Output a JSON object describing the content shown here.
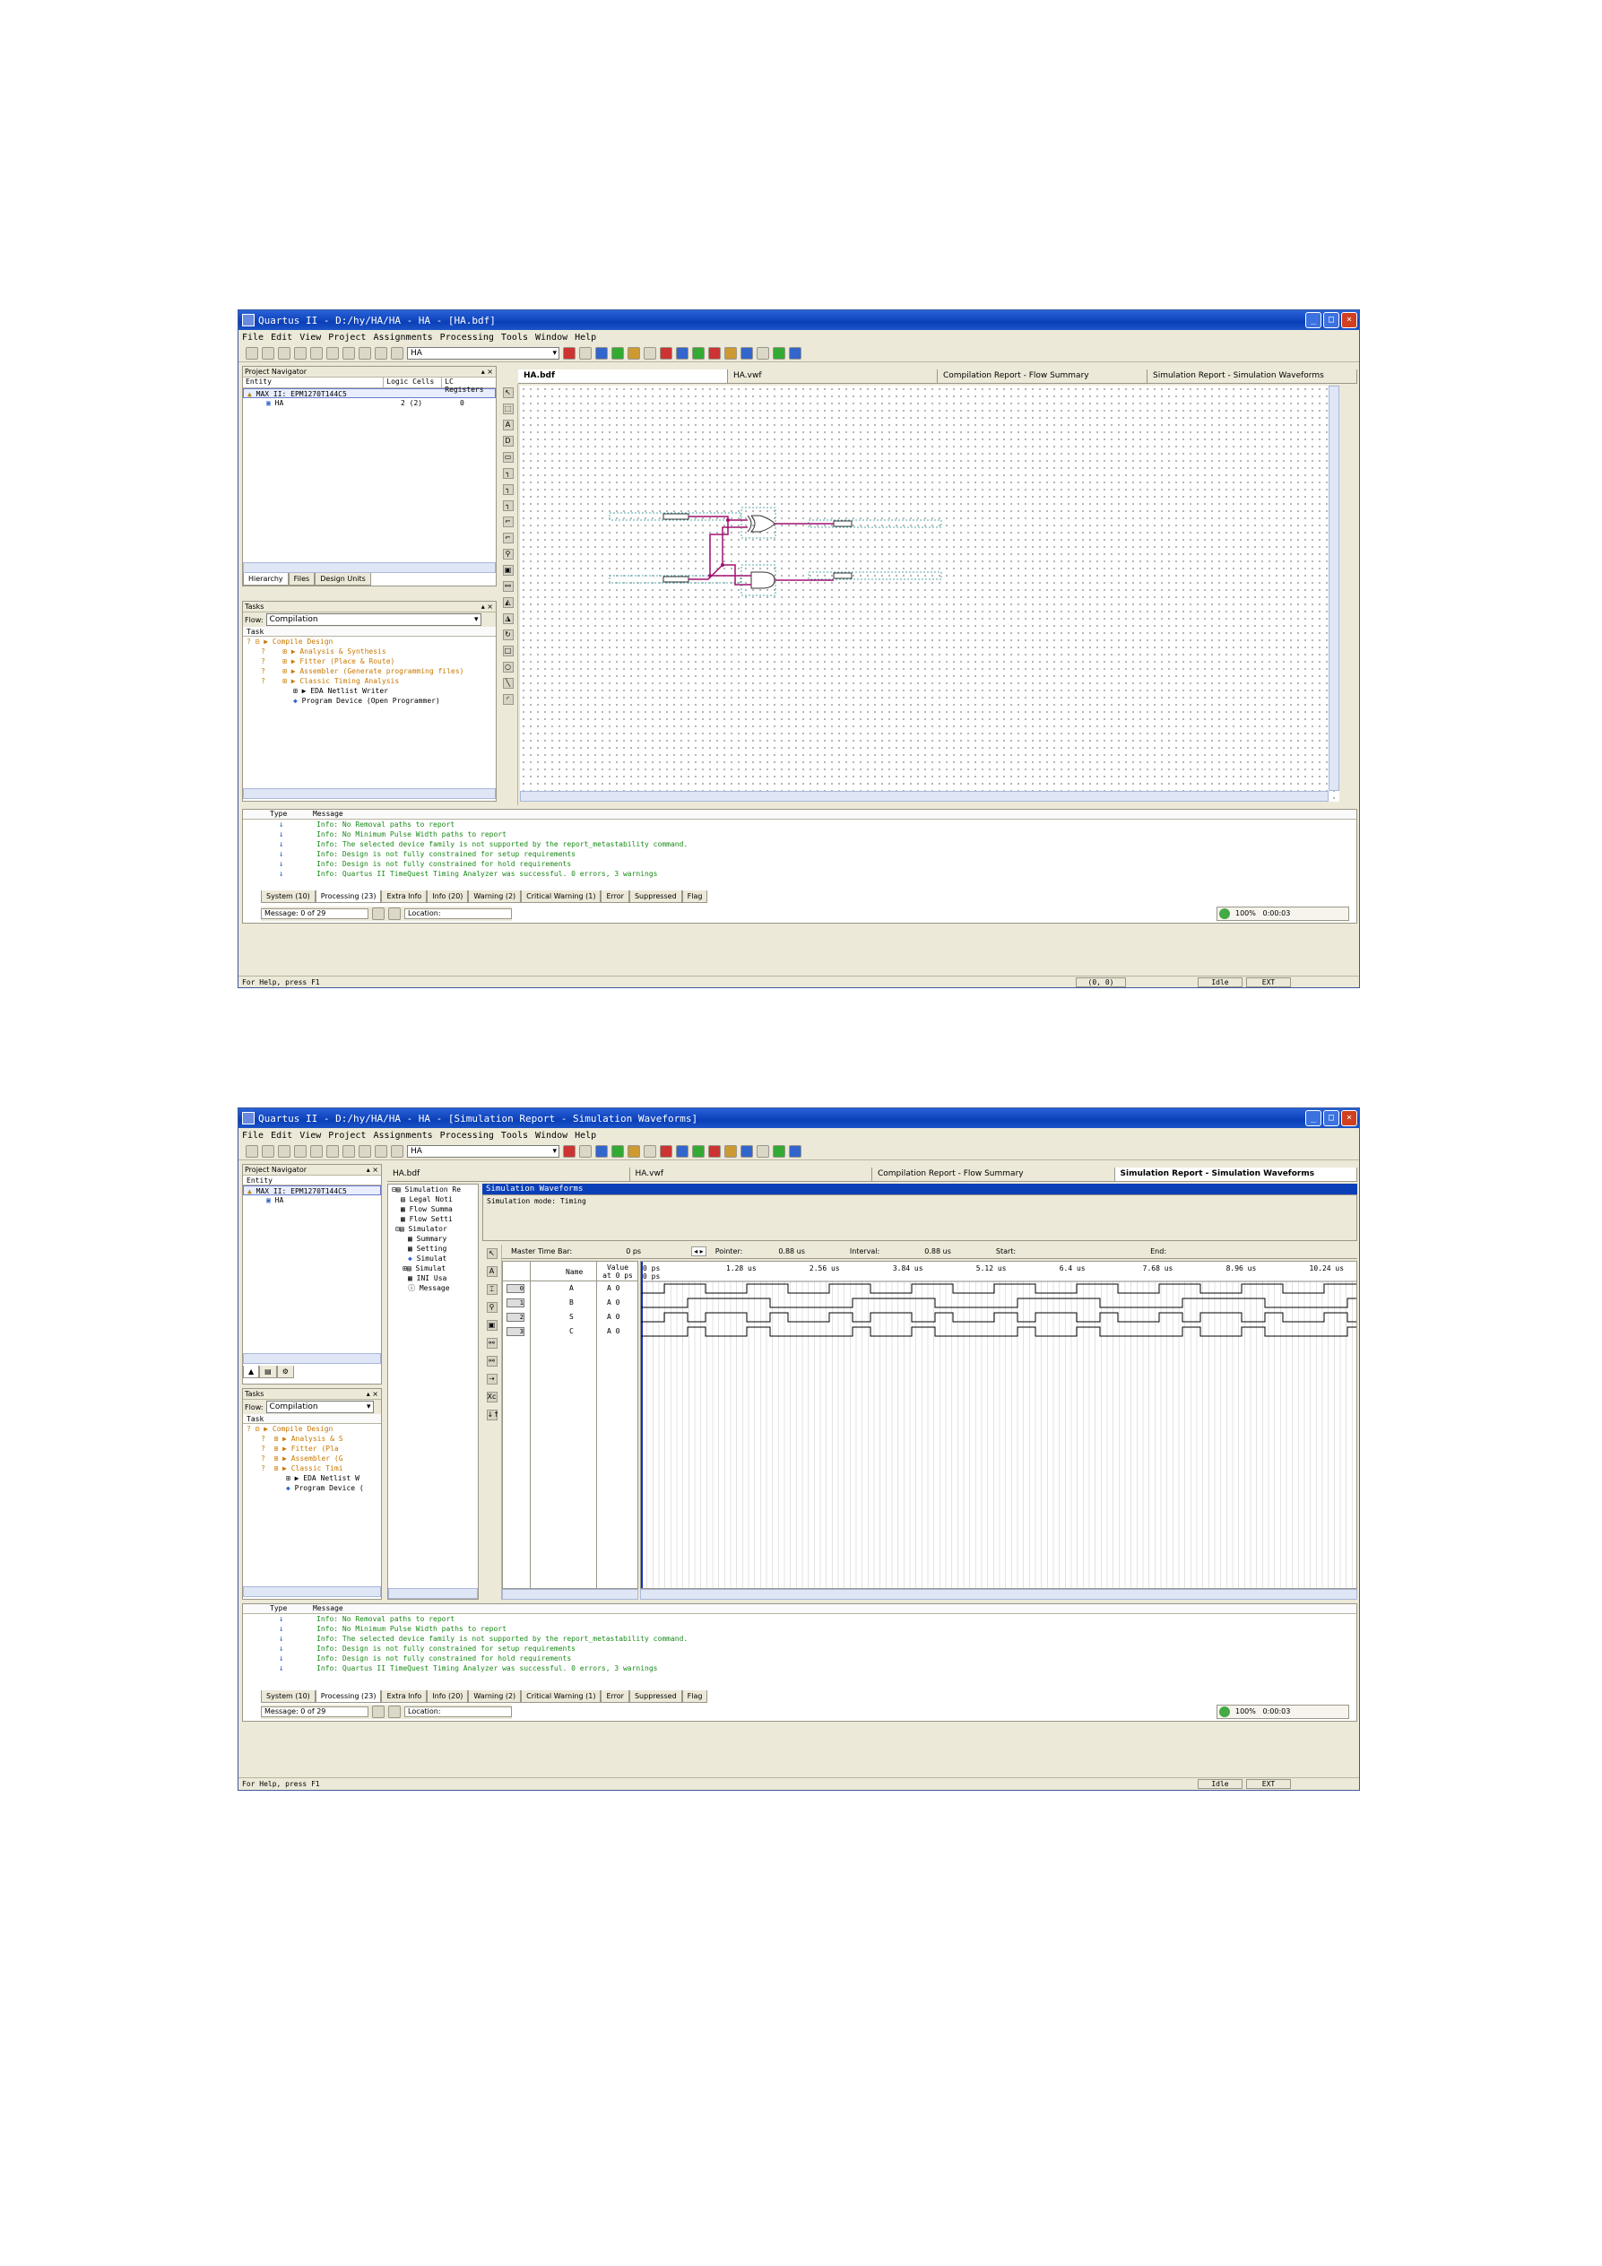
{
  "app": {
    "title1": "Quartus II - D:/hy/HA/HA - HA - [HA.bdf]",
    "title2": "Quartus II - D:/hy/HA/HA - HA - [Simulation Report - Simulation Waveforms]",
    "menu": [
      "File",
      "Edit",
      "View",
      "Project",
      "Assignments",
      "Processing",
      "Tools",
      "Window",
      "Help"
    ],
    "toolbar_project": "HA"
  },
  "navigator": {
    "header": "Project Navigator",
    "col_entity": "Entity",
    "col_logic": "Logic Cells",
    "col_lc": "LC Registers",
    "device": "MAX II: EPM1270T144C5",
    "device_short": "MAX II: EPM1270T144C5",
    "entity": "HA",
    "logic_cells": "2 (2)",
    "lc_regs": "0",
    "tabs": [
      "Hierarchy",
      "Files",
      "Design Units"
    ]
  },
  "tasks": {
    "header": "Tasks",
    "flow_label": "Flow:",
    "flow_value": "Compilation",
    "col": "Task",
    "items": [
      "Compile Design",
      "Analysis & Synthesis",
      "Fitter (Place & Route)",
      "Assembler (Generate programming files)",
      "Classic Timing Analysis",
      "EDA Netlist Writer",
      "Program Device (Open Programmer)"
    ],
    "items_short": [
      "Compile Design",
      "Analysis & S",
      "Fitter (Pla",
      "Assembler (G",
      "Classic Timi",
      "EDA Netlist W",
      "Program Device ("
    ]
  },
  "doc_tabs": [
    "HA.bdf",
    "HA.vwf",
    "Compilation Report - Flow Summary",
    "Simulation Report - Simulation Waveforms"
  ],
  "messages": {
    "col_type": "Type",
    "col_message": "Message",
    "lines": [
      "Info: No Removal paths to report",
      "Info: No Minimum Pulse Width paths to report",
      "Info: The selected device family is not supported by the report_metastability command.",
      "Info: Design is not fully constrained for setup requirements",
      "Info: Design is not fully constrained for hold requirements",
      "Info: Quartus II TimeQuest Timing Analyzer was successful. 0 errors, 3 warnings"
    ],
    "tabs": [
      "System (10)",
      "Processing (23)",
      "Extra Info",
      "Info (20)",
      "Warning (2)",
      "Critical Warning (1)",
      "Error",
      "Suppressed",
      "Flag"
    ],
    "counter": "Message: 0 of 29",
    "location": "Location:",
    "tray": "0:00:03",
    "tray_pct": "100%"
  },
  "status": {
    "help": "For Help, press F1",
    "idle": "Idle",
    "ext": "EXT",
    "coord": "(0, 0)"
  },
  "sim_tree": {
    "items": [
      "Simulation Report",
      "Legal Notice",
      "Flow Summary",
      "Flow Settings",
      "Simulator",
      "Summary",
      "Settings",
      "Simulation Waveforms",
      "Simulation Coverage",
      "INI Usage",
      "Messages"
    ],
    "items_short": [
      "Simulation Re",
      "Legal Noti",
      "Flow Summa",
      "Flow Setti",
      "Simulator",
      "Summary",
      "Setting",
      "Simulat",
      "Simulat",
      "INI Usa",
      "Message"
    ]
  },
  "waveform": {
    "heading": "Simulation Waveforms",
    "mode": "Simulation mode: Timing",
    "master_label": "Master Time Bar:",
    "master_val": "0 ps",
    "pointer_label": "Pointer:",
    "pointer_val": "0.88 us",
    "interval_label": "Interval:",
    "interval_val": "0.88 us",
    "start_label": "Start:",
    "end_label": "End:",
    "col_name": "Name",
    "col_value": "Value at 0 ps",
    "ticks": [
      "0 ps",
      "1.28 us",
      "2.56 us",
      "3.84 us",
      "5.12 us",
      "6.4 us",
      "7.68 us",
      "8.96 us",
      "10.24 us"
    ],
    "signals": [
      {
        "idx": "0",
        "name": "A",
        "value": "A 0"
      },
      {
        "idx": "1",
        "name": "B",
        "value": "A 0"
      },
      {
        "idx": "2",
        "name": "S",
        "value": "A 0"
      },
      {
        "idx": "3",
        "name": "C",
        "value": "A 0"
      }
    ]
  },
  "colors": {
    "title": "#0a3fb8",
    "wire": "#a01070",
    "wave": "#000000",
    "info": "#1a8a1a",
    "task_warn": "#c87800"
  }
}
